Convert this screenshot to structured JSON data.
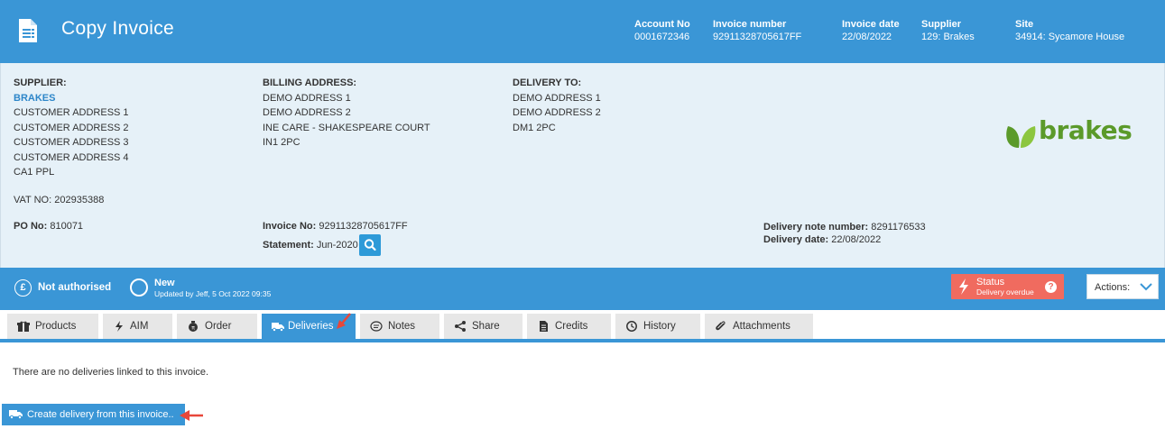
{
  "header": {
    "title": "Copy Invoice",
    "meta": [
      {
        "key": "Account No",
        "value": "0001672346"
      },
      {
        "key": "Invoice number",
        "value": "92911328705617FF"
      },
      {
        "key": "Invoice date",
        "value": "22/08/2022"
      },
      {
        "key": "Supplier",
        "value": "129: Brakes"
      },
      {
        "key": "Site",
        "value": "34914: Sycamore House"
      }
    ]
  },
  "supplier": {
    "heading": "SUPPLIER:",
    "name": "BRAKES",
    "lines": [
      "CUSTOMER ADDRESS 1",
      "CUSTOMER ADDRESS 2",
      "CUSTOMER ADDRESS 3",
      "CUSTOMER ADDRESS 4",
      "CA1 PPL"
    ],
    "vat_label": "VAT NO:",
    "vat_value": "202935388"
  },
  "billing": {
    "heading": "BILLING ADDRESS:",
    "lines": [
      "DEMO ADDRESS 1",
      "DEMO ADDRESS 2",
      "INE CARE - SHAKESPEARE COURT",
      "IN1 2PC"
    ]
  },
  "delivery_to": {
    "heading": "DELIVERY TO:",
    "lines": [
      "DEMO ADDRESS 1",
      "DEMO ADDRESS 2",
      "DM1 2PC"
    ]
  },
  "po": {
    "label": "PO No:",
    "value": "810071"
  },
  "invoice": {
    "label": "Invoice No:",
    "value": "92911328705617FF"
  },
  "statement": {
    "label": "Statement:",
    "value": "Jun-2020"
  },
  "delivery_note": {
    "label": "Delivery note number:",
    "value": "8291176533"
  },
  "delivery_date": {
    "label": "Delivery date:",
    "value": "22/08/2022"
  },
  "logo_text": "brakes",
  "status_bar": {
    "auth": "Not authorised",
    "state": "New",
    "updated": "Updated by Jeff, 5 Oct 2022 09:35",
    "status_title": "Status",
    "status_sub": "Delivery overdue",
    "actions_label": "Actions:"
  },
  "tabs": [
    {
      "label": "Products",
      "icon": "gift-icon"
    },
    {
      "label": "AIM",
      "icon": "bolt-icon"
    },
    {
      "label": "Order",
      "icon": "order-icon"
    },
    {
      "label": "Deliveries",
      "icon": "truck-icon"
    },
    {
      "label": "Notes",
      "icon": "chat-icon"
    },
    {
      "label": "Share",
      "icon": "share-icon"
    },
    {
      "label": "Credits",
      "icon": "document-icon"
    },
    {
      "label": "History",
      "icon": "clock-icon"
    },
    {
      "label": "Attachments",
      "icon": "paperclip-icon"
    }
  ],
  "deliveries": {
    "empty_message": "There are no deliveries linked to this invoice.",
    "create_button": "Create delivery from this invoice.."
  },
  "colors": {
    "primary": "#3a96d6",
    "panel": "#e6f1f8",
    "alert": "#f06b5f",
    "brand_green": "#5b9a2a"
  }
}
